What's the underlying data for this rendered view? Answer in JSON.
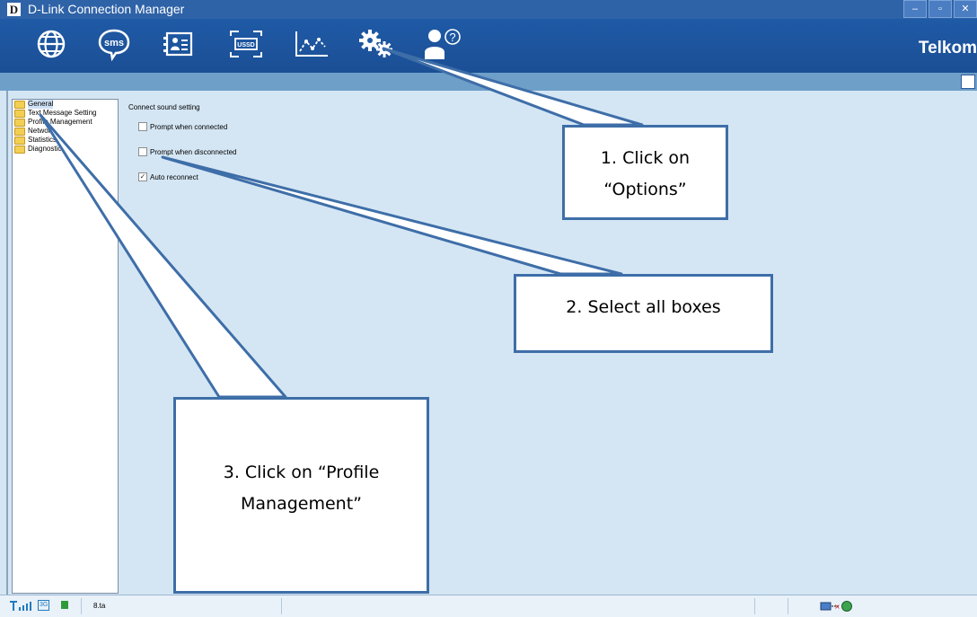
{
  "window": {
    "title": "D-Link Connection Manager",
    "logo_text": "D"
  },
  "toolbar": {
    "icons": [
      "internet-globe-icon",
      "sms-icon",
      "contacts-icon",
      "ussd-icon",
      "statistics-icon",
      "options-gear-icon",
      "help-icon"
    ],
    "sms_text": "sms",
    "ussd_text": "USSD",
    "help_glyph": "?",
    "brand": "Telkom"
  },
  "tree": {
    "items": [
      {
        "label": "General"
      },
      {
        "label": "Text Message Setting"
      },
      {
        "label": "Profile Management"
      },
      {
        "label": "Network"
      },
      {
        "label": "Statistics"
      },
      {
        "label": "Diagnostics"
      }
    ]
  },
  "general": {
    "section_title": "Connect sound setting",
    "options": [
      {
        "label": "Prompt when connected",
        "checked": false
      },
      {
        "label": "Prompt when disconnected",
        "checked": false
      },
      {
        "label": "Auto reconnect",
        "checked": true
      }
    ]
  },
  "callouts": {
    "c1": "1. Click on “Options”",
    "c2": "2. Select all boxes",
    "c3": "3. Click on “Profile Management”"
  },
  "statusbar": {
    "network_type": "3G",
    "operator": "8.ta"
  },
  "colors": {
    "title_bar": "#2f63a8",
    "toolbar": "#1f5aa6",
    "sub_bar": "#6e9fc9",
    "background": "#d4e6f4",
    "callout_border": "#3e6ea8"
  }
}
